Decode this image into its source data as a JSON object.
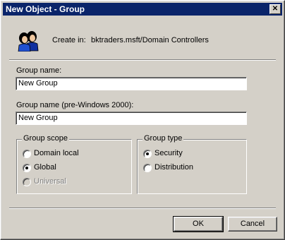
{
  "window": {
    "title": "New Object - Group",
    "close_symbol": "✕"
  },
  "header": {
    "create_label": "Create in:",
    "create_value": "bktraders.msft/Domain Controllers",
    "icon": "group-users-icon"
  },
  "form": {
    "group_name_label": "Group name:",
    "group_name_value": "New Group",
    "pre2000_label": "Group name (pre-Windows 2000):",
    "pre2000_value": "New Group"
  },
  "scope": {
    "title": "Group scope",
    "options": [
      {
        "label": "Domain local",
        "checked": false,
        "enabled": true
      },
      {
        "label": "Global",
        "checked": true,
        "enabled": true
      },
      {
        "label": "Universal",
        "checked": false,
        "enabled": false
      }
    ]
  },
  "type": {
    "title": "Group type",
    "options": [
      {
        "label": "Security",
        "checked": true,
        "enabled": true
      },
      {
        "label": "Distribution",
        "checked": false,
        "enabled": true
      }
    ]
  },
  "buttons": {
    "ok": "OK",
    "cancel": "Cancel"
  },
  "colors": {
    "titlebar": "#0a246a",
    "face": "#d4d0c8"
  }
}
